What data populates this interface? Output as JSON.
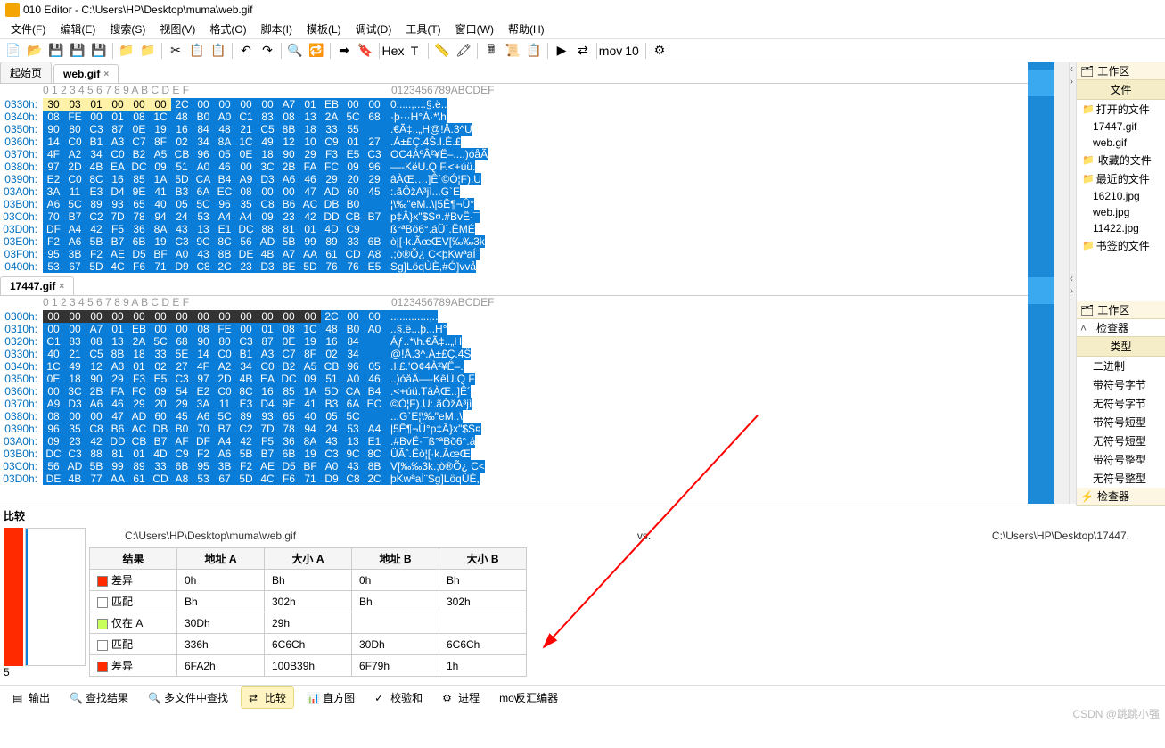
{
  "title": "010 Editor - C:\\Users\\HP\\Desktop\\muma\\web.gif",
  "menu": [
    "文件(F)",
    "编辑(E)",
    "搜索(S)",
    "视图(V)",
    "格式(O)",
    "脚本(I)",
    "模板(L)",
    "调试(D)",
    "工具(T)",
    "窗口(W)",
    "帮助(H)"
  ],
  "toolbar_icons": [
    "new-file",
    "open-file",
    "save",
    "save-all",
    "save-as",
    "sep",
    "folder-open",
    "folder-recent",
    "sep",
    "cut",
    "copy",
    "paste",
    "sep",
    "undo",
    "redo",
    "sep",
    "find",
    "find-replace",
    "sep",
    "goto",
    "bookmark",
    "sep",
    "hex-mode",
    "text-mode",
    "sep",
    "ruler",
    "highlight",
    "sep",
    "calc",
    "script",
    "template",
    "sep",
    "run",
    "compare",
    "sep",
    "mov",
    "binary",
    "sep",
    "settings"
  ],
  "tabs_file": {
    "start": "起始页",
    "current": "web.gif"
  },
  "hex1": {
    "cols": " 0  1  2  3  4  5  6  7  8  9  A  B  C  D  E  F",
    "asc_hdr": "0123456789ABCDEF",
    "rows": [
      {
        "ofs": "0330h:",
        "y": [
          "30",
          "03",
          "01",
          "00",
          "00",
          "00"
        ],
        "b": [
          "2C",
          "00",
          "00",
          "00",
          "00",
          "A7",
          "01",
          "EB",
          "00",
          "00"
        ],
        "asc": "0.....,....§.ë.."
      },
      {
        "ofs": "0340h:",
        "b": [
          "08",
          "FE",
          "00",
          "01",
          "08",
          "1C",
          "48",
          "B0",
          "A0",
          "C1",
          "83",
          "08",
          "13",
          "2A",
          "5C",
          "68"
        ],
        "asc": "·þ···H°Á·*\\h"
      },
      {
        "ofs": "0350h:",
        "b": [
          "90",
          "80",
          "C3",
          "87",
          "0E",
          "19",
          "16",
          "84",
          "48",
          "21",
          "C5",
          "8B",
          "18",
          "33",
          "55"
        ],
        "asc": ".€Ã‡..„H@!Å.3^U"
      },
      {
        "ofs": "0360h:",
        "b": [
          "14",
          "C0",
          "B1",
          "A3",
          "C7",
          "8F",
          "02",
          "34",
          "8A",
          "1C",
          "49",
          "12",
          "10",
          "C9",
          "01",
          "27"
        ],
        "asc": ".À±£Ç.4Š.I.É.£"
      },
      {
        "ofs": "0370h:",
        "b": [
          "4F",
          "A2",
          "34",
          "C0",
          "B2",
          "A5",
          "CB",
          "96",
          "05",
          "0E",
          "18",
          "90",
          "29",
          "F3",
          "E5",
          "C3"
        ],
        "asc": "OC4ÀºÂ²¥Ë–....)óåÃ"
      },
      {
        "ofs": "0380h:",
        "b": [
          "97",
          "2D",
          "4B",
          "EA",
          "DC",
          "09",
          "51",
          "A0",
          "46",
          "00",
          "3C",
          "2B",
          "FA",
          "FC",
          "09",
          "96"
        ],
        "asc": "—-KëU.Q F.<+úü."
      },
      {
        "ofs": "0390h:",
        "b": [
          "E2",
          "C0",
          "8C",
          "16",
          "85",
          "1A",
          "5D",
          "CA",
          "B4",
          "A9",
          "D3",
          "A6",
          "46",
          "29",
          "20",
          "29"
        ],
        "asc": "âÀŒ….]Ê´©Ó¦F).U"
      },
      {
        "ofs": "03A0h:",
        "b": [
          "3A",
          "11",
          "E3",
          "D4",
          "9E",
          "41",
          "B3",
          "6A",
          "EC",
          "08",
          "00",
          "00",
          "47",
          "AD",
          "60",
          "45"
        ],
        "asc": ":.ãÔžA³jì...G­`E"
      },
      {
        "ofs": "03B0h:",
        "b": [
          "A6",
          "5C",
          "89",
          "93",
          "65",
          "40",
          "05",
          "5C",
          "96",
          "35",
          "C8",
          "B6",
          "AC",
          "DB",
          "B0"
        ],
        "asc": "¦\\‰\"eM..\\|5Ê¶¬Û°"
      },
      {
        "ofs": "03C0h:",
        "b": [
          "70",
          "B7",
          "C2",
          "7D",
          "78",
          "94",
          "24",
          "53",
          "A4",
          "A4",
          "09",
          "23",
          "42",
          "DD",
          "CB",
          "B7",
          "AF"
        ],
        "asc": "p‡Â}x\"$S¤.#BvË·¯"
      },
      {
        "ofs": "03D0h:",
        "b": [
          "DF",
          "A4",
          "42",
          "F5",
          "36",
          "8A",
          "43",
          "13",
          "E1",
          "DC",
          "88",
          "81",
          "01",
          "4D",
          "C9"
        ],
        "asc": "ß°ªBõ6°.áÜˆ.ËMÉ"
      },
      {
        "ofs": "03E0h:",
        "b": [
          "F2",
          "A6",
          "5B",
          "B7",
          "6B",
          "19",
          "C3",
          "9C",
          "8C",
          "56",
          "AD",
          "5B",
          "99",
          "89",
          "33",
          "6B"
        ],
        "asc": "ò¦[·k.ÃœŒV­[‰‰3k"
      },
      {
        "ofs": "03F0h:",
        "b": [
          "95",
          "3B",
          "F2",
          "AE",
          "D5",
          "BF",
          "A0",
          "43",
          "8B",
          "DE",
          "4B",
          "A7",
          "AA",
          "61",
          "CD",
          "A8"
        ],
        "asc": ".;ò®Õ¿ C<þKwªaÍ¨"
      },
      {
        "ofs": "0400h:",
        "b": [
          "53",
          "67",
          "5D",
          "4C",
          "F6",
          "71",
          "D9",
          "C8",
          "2C",
          "23",
          "D3",
          "8E",
          "5D",
          "76",
          "76",
          "E5"
        ],
        "asc": "Sg]LöqÙÈ,#Ó]vvå"
      }
    ]
  },
  "tabs_file2": {
    "current": "17447.gif"
  },
  "hex2": {
    "cols": " 0  1  2  3  4  5  6  7  8  9  A  B  C  D  E  F",
    "asc_hdr": "0123456789ABCDEF",
    "rows": [
      {
        "ofs": "0300h:",
        "k": [
          "00",
          "00",
          "00",
          "00",
          "00",
          "00",
          "00",
          "00",
          "00",
          "00",
          "00",
          "00",
          "00"
        ],
        "b": [
          "2C",
          "00",
          "00"
        ],
        "asc": ".............,.."
      },
      {
        "ofs": "0310h:",
        "b": [
          "00",
          "00",
          "A7",
          "01",
          "EB",
          "00",
          "00",
          "08",
          "FE",
          "00",
          "01",
          "08",
          "1C",
          "48",
          "B0",
          "A0"
        ],
        "asc": "..§.ë...þ...H°"
      },
      {
        "ofs": "0320h:",
        "b": [
          "C1",
          "83",
          "08",
          "13",
          "2A",
          "5C",
          "68",
          "90",
          "80",
          "C3",
          "87",
          "0E",
          "19",
          "16",
          "84"
        ],
        "asc": "Áƒ..*\\h.€Ã‡..„H"
      },
      {
        "ofs": "0330h:",
        "b": [
          "40",
          "21",
          "C5",
          "8B",
          "18",
          "33",
          "5E",
          "14",
          "C0",
          "B1",
          "A3",
          "C7",
          "8F",
          "02",
          "34"
        ],
        "asc": "@!Å.3^.À±£Ç.4Š"
      },
      {
        "ofs": "0340h:",
        "b": [
          "1C",
          "49",
          "12",
          "A3",
          "01",
          "02",
          "27",
          "4F",
          "A2",
          "34",
          "C0",
          "B2",
          "A5",
          "CB",
          "96",
          "05"
        ],
        "asc": ".I.£.'O¢4À²¥Ë–."
      },
      {
        "ofs": "0350h:",
        "b": [
          "0E",
          "18",
          "90",
          "29",
          "F3",
          "E5",
          "C3",
          "97",
          "2D",
          "4B",
          "EA",
          "DC",
          "09",
          "51",
          "A0",
          "46"
        ],
        "asc": "..)óåÃ—-KêÜ.Q F"
      },
      {
        "ofs": "0360h:",
        "b": [
          "00",
          "3C",
          "2B",
          "FA",
          "FC",
          "09",
          "54",
          "E2",
          "C0",
          "8C",
          "16",
          "85",
          "1A",
          "5D",
          "CA",
          "B4"
        ],
        "asc": ".<+úü.TâÀŒ..]Ê´"
      },
      {
        "ofs": "0370h:",
        "b": [
          "A9",
          "D3",
          "A6",
          "46",
          "29",
          "20",
          "29",
          "3A",
          "11",
          "E3",
          "D4",
          "9E",
          "41",
          "B3",
          "6A",
          "EC"
        ],
        "asc": "©Ó¦F).U:.ãÔžA³jì"
      },
      {
        "ofs": "0380h:",
        "b": [
          "08",
          "00",
          "00",
          "47",
          "AD",
          "60",
          "45",
          "A6",
          "5C",
          "89",
          "93",
          "65",
          "40",
          "05",
          "5C"
        ],
        "asc": "...G­`E¦\\‰\"eM..\\"
      },
      {
        "ofs": "0390h:",
        "b": [
          "96",
          "35",
          "C8",
          "B6",
          "AC",
          "DB",
          "B0",
          "70",
          "B7",
          "C2",
          "7D",
          "78",
          "94",
          "24",
          "53",
          "A4"
        ],
        "asc": "|5Ê¶¬Û°p‡Â}x\"$S¤"
      },
      {
        "ofs": "03A0h:",
        "b": [
          "09",
          "23",
          "42",
          "DD",
          "CB",
          "B7",
          "AF",
          "DF",
          "A4",
          "42",
          "F5",
          "36",
          "8A",
          "43",
          "13",
          "E1"
        ],
        "asc": ".#BvË·¯ß°ªBõ6°.á"
      },
      {
        "ofs": "03B0h:",
        "b": [
          "DC",
          "C3",
          "88",
          "81",
          "01",
          "4D",
          "C9",
          "F2",
          "A6",
          "5B",
          "B7",
          "6B",
          "19",
          "C3",
          "9C",
          "8C"
        ],
        "asc": "ÜÃˆ.Ëò¦[·k.ÃœŒ"
      },
      {
        "ofs": "03C0h:",
        "b": [
          "56",
          "AD",
          "5B",
          "99",
          "89",
          "33",
          "6B",
          "95",
          "3B",
          "F2",
          "AE",
          "D5",
          "BF",
          "A0",
          "43",
          "8B"
        ],
        "asc": "V­[‰‰3k.;ò®Õ¿ C<"
      },
      {
        "ofs": "03D0h:",
        "b": [
          "DE",
          "4B",
          "77",
          "AA",
          "61",
          "CD",
          "A8",
          "53",
          "67",
          "5D",
          "4C",
          "F6",
          "71",
          "D9",
          "C8",
          "2C"
        ],
        "asc": "þKwªaÍ¨Sg]LöqÙÈ,"
      }
    ]
  },
  "compare": {
    "title": "比较",
    "pathA": "C:\\Users\\HP\\Desktop\\muma\\web.gif",
    "vs": "vs.",
    "pathB": "C:\\Users\\HP\\Desktop\\17447.",
    "cols": [
      "结果",
      "地址 A",
      "大小 A",
      "地址 B",
      "大小 B"
    ],
    "rows": [
      {
        "sw": "r",
        "r": "差异",
        "aA": "0h",
        "sA": "Bh",
        "aB": "0h",
        "sB": "Bh"
      },
      {
        "sw": "w",
        "r": "匹配",
        "aA": "Bh",
        "sA": "302h",
        "aB": "Bh",
        "sB": "302h"
      },
      {
        "sw": "g",
        "r": "仅在 A",
        "aA": "30Dh",
        "sA": "29h",
        "aB": "",
        "sB": ""
      },
      {
        "sw": "w",
        "r": "匹配",
        "aA": "336h",
        "sA": "6C6Ch",
        "aB": "30Dh",
        "sB": "6C6Ch"
      },
      {
        "sw": "r",
        "r": "差异",
        "aA": "6FA2h",
        "sA": "100B39h",
        "aB": "6F79h",
        "sB": "1h"
      }
    ],
    "footnum": "5"
  },
  "bottom_tabs": [
    "输出",
    "查找结果",
    "多文件中查找",
    "比较",
    "直方图",
    "校验和",
    "进程",
    "反汇编器"
  ],
  "bottom_active": 3,
  "right": {
    "panel1": "工作区",
    "files_hdr": "文件",
    "open": "打开的文件",
    "open_items": [
      "17447.gif",
      "web.gif"
    ],
    "fav": "收藏的文件",
    "recent": "最近的文件",
    "recent_items": [
      "16210.jpg",
      "web.jpg",
      "11422.jpg"
    ],
    "bookmarks": "书签的文件",
    "panel2": "工作区",
    "inspector": "检查器",
    "types_hdr": "类型",
    "types": [
      "二进制",
      "带符号字节",
      "无符号字节",
      "带符号短型",
      "无符号短型",
      "带符号整型",
      "无符号整型"
    ],
    "inspector2": "检查器"
  },
  "watermark": "CSDN @跳跳小强"
}
